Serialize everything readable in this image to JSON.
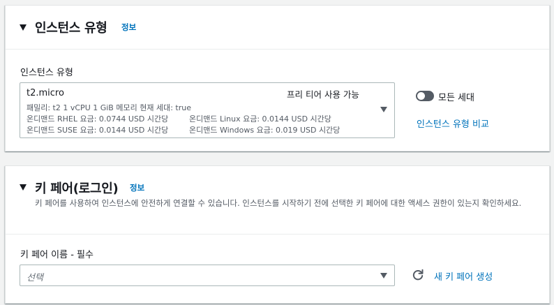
{
  "instance_type_panel": {
    "title": "인스턴스 유형",
    "info_link": "정보",
    "field_label": "인스턴스 유형",
    "selected": {
      "name": "t2.micro",
      "free_tier": "프리 티어 사용 가능",
      "specs": "패밀리: t2    1 vCPU    1 GiB 메모리    현재 세대: true",
      "rhel_price": "온디맨드 RHEL 요금: 0.0744 USD 시간당",
      "linux_price": "온디맨드 Linux 요금: 0.0144 USD 시간당",
      "suse_price": "온디맨드 SUSE 요금: 0.0144 USD 시간당",
      "windows_price": "온디맨드 Windows 요금: 0.019 USD 시간당"
    },
    "all_generations_toggle": {
      "label": "모든 세대",
      "on": false
    },
    "compare_link": "인스턴스 유형 비교"
  },
  "key_pair_panel": {
    "title": "키 페어(로그인)",
    "info_link": "정보",
    "description": "키 페어를 사용하여 인스턴스에 안전하게 연결할 수 있습니다. 인스턴스를 시작하기 전에 선택한 키 페어에 대한 액세스 권한이 있는지 확인하세요.",
    "field_label": "키 페어 이름 - 필수",
    "select_placeholder": "선택",
    "create_link": "새 키 페어 생성"
  },
  "colors": {
    "link": "#0073bb",
    "text": "#16191f",
    "secondary_text": "#545b64",
    "toggle_off": "#545b64"
  },
  "icons": [
    "caret-down-icon",
    "dropdown-arrow-icon",
    "toggle-switch",
    "refresh-icon"
  ]
}
